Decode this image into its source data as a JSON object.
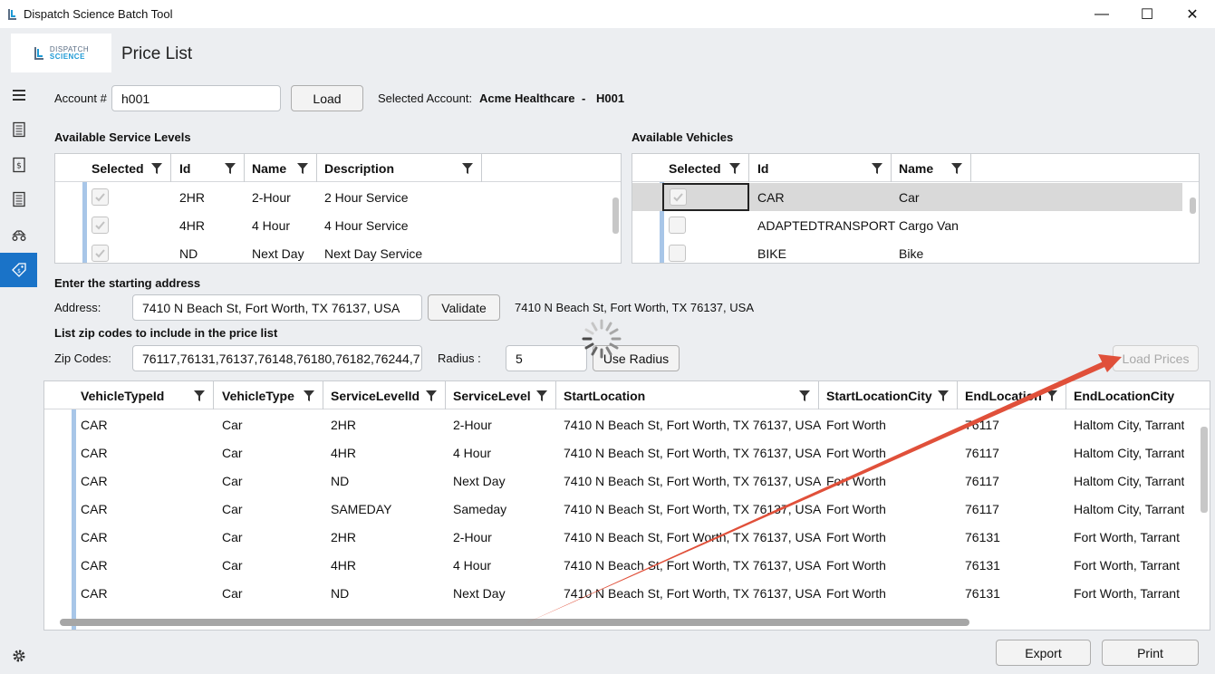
{
  "window": {
    "title": "Dispatch Science Batch Tool",
    "minimize": "—",
    "maximize": "☐",
    "close": "✕"
  },
  "header": {
    "logo_line1": "DISPATCH",
    "logo_line2": "SCIENCE",
    "page_title": "Price List"
  },
  "sidebar": {
    "items": [
      "menu-icon",
      "list-icon",
      "invoice-icon",
      "report-icon",
      "delivery-icon",
      "price-tag-icon",
      "settings-icon"
    ],
    "active": "price-tag-icon"
  },
  "account": {
    "label": "Account #",
    "value": "h001",
    "load_label": "Load",
    "selected_label": "Selected Account:",
    "selected_name": "Acme Healthcare",
    "separator": "-",
    "selected_code": "H001"
  },
  "service_levels": {
    "title": "Available Service Levels",
    "columns": [
      "Selected",
      "Id",
      "Name",
      "Description"
    ],
    "rows": [
      {
        "selected": true,
        "id": "2HR",
        "name": "2-Hour",
        "description": "2 Hour Service"
      },
      {
        "selected": true,
        "id": "4HR",
        "name": "4 Hour",
        "description": "4 Hour Service"
      },
      {
        "selected": true,
        "id": "ND",
        "name": "Next Day",
        "description": "Next Day Service"
      }
    ]
  },
  "vehicles": {
    "title": "Available Vehicles",
    "columns": [
      "Selected",
      "Id",
      "Name"
    ],
    "rows": [
      {
        "selected": true,
        "id": "CAR",
        "name": "Car"
      },
      {
        "selected": false,
        "id": "ADAPTEDTRANSPORT",
        "name": "Cargo Van"
      },
      {
        "selected": false,
        "id": "BIKE",
        "name": "Bike"
      }
    ]
  },
  "address": {
    "section_title": "Enter the starting address",
    "label": "Address:",
    "value": "7410 N Beach St, Fort Worth, TX 76137, USA",
    "validate_label": "Validate",
    "validated": "7410 N Beach St, Fort Worth, TX 76137, USA"
  },
  "zip": {
    "section_title": "List zip codes to include in the price list",
    "label": "Zip Codes:",
    "value": "76117,76131,76137,76148,76180,76182,76244,7",
    "radius_label": "Radius :",
    "radius_value": "5",
    "use_radius_label": "Use Radius",
    "load_prices_label": "Load Prices"
  },
  "prices": {
    "columns": [
      "VehicleTypeId",
      "VehicleType",
      "ServiceLevelId",
      "ServiceLevel",
      "StartLocation",
      "StartLocationCity",
      "EndLocation",
      "EndLocationCity"
    ],
    "rows": [
      [
        "CAR",
        "Car",
        "2HR",
        "2-Hour",
        "7410 N Beach St, Fort Worth, TX 76137, USA",
        "Fort Worth",
        "76117",
        "Haltom City, Tarrant"
      ],
      [
        "CAR",
        "Car",
        "4HR",
        "4 Hour",
        "7410 N Beach St, Fort Worth, TX 76137, USA",
        "Fort Worth",
        "76117",
        "Haltom City, Tarrant"
      ],
      [
        "CAR",
        "Car",
        "ND",
        "Next Day",
        "7410 N Beach St, Fort Worth, TX 76137, USA",
        "Fort Worth",
        "76117",
        "Haltom City, Tarrant"
      ],
      [
        "CAR",
        "Car",
        "SAMEDAY",
        "Sameday",
        "7410 N Beach St, Fort Worth, TX 76137, USA",
        "Fort Worth",
        "76117",
        "Haltom City, Tarrant"
      ],
      [
        "CAR",
        "Car",
        "2HR",
        "2-Hour",
        "7410 N Beach St, Fort Worth, TX 76137, USA",
        "Fort Worth",
        "76131",
        "Fort Worth, Tarrant"
      ],
      [
        "CAR",
        "Car",
        "4HR",
        "4 Hour",
        "7410 N Beach St, Fort Worth, TX 76137, USA",
        "Fort Worth",
        "76131",
        "Fort Worth, Tarrant"
      ],
      [
        "CAR",
        "Car",
        "ND",
        "Next Day",
        "7410 N Beach St, Fort Worth, TX 76137, USA",
        "Fort Worth",
        "76131",
        "Fort Worth, Tarrant"
      ]
    ]
  },
  "footer": {
    "export_label": "Export",
    "print_label": "Print"
  },
  "colors": {
    "accent": "#1a73c8",
    "annotation_arrow": "#e0503a",
    "row_marker": "#a8c6e8"
  }
}
